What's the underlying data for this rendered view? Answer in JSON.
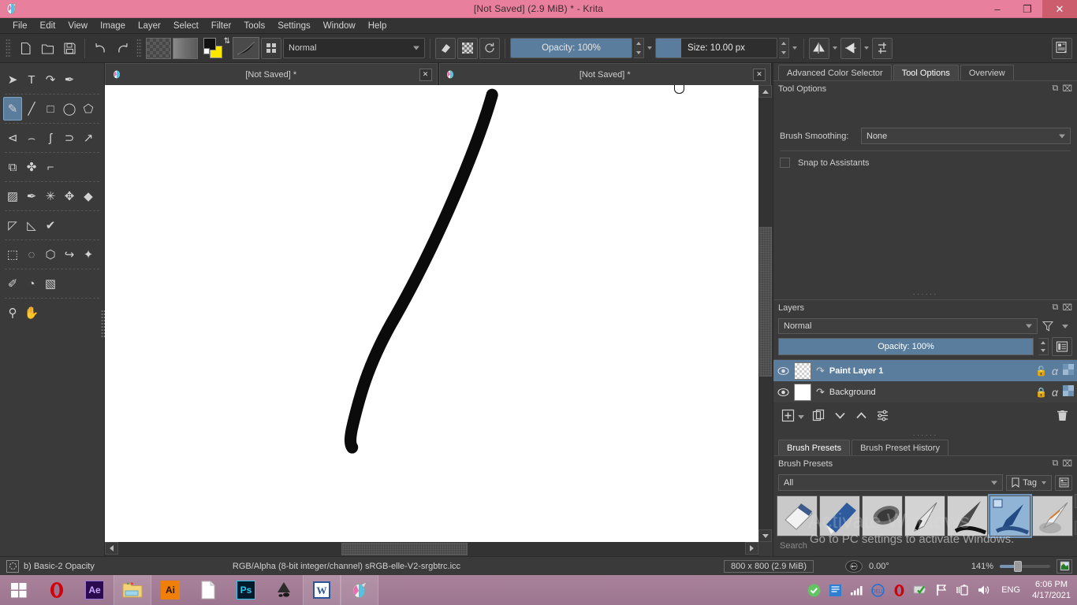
{
  "titlebar": {
    "title": "[Not Saved]  (2.9 MiB)  * - Krita",
    "app_icon": "krita-icon",
    "minimize": "–",
    "maximize": "❐",
    "close": "✕"
  },
  "menubar": {
    "items": [
      {
        "label": "File",
        "accel": "F"
      },
      {
        "label": "Edit",
        "accel": "E"
      },
      {
        "label": "View",
        "accel": "V"
      },
      {
        "label": "Image",
        "accel": "I"
      },
      {
        "label": "Layer",
        "accel": "L"
      },
      {
        "label": "Select",
        "accel": "S"
      },
      {
        "label": "Filter",
        "accel": "r"
      },
      {
        "label": "Tools",
        "accel": "T"
      },
      {
        "label": "Settings",
        "accel": "n"
      },
      {
        "label": "Window",
        "accel": "W"
      },
      {
        "label": "Help",
        "accel": "H"
      }
    ]
  },
  "toolbar": {
    "new_label": "new-file",
    "open_label": "open-file",
    "save_label": "save-file",
    "undo_label": "undo",
    "redo_label": "redo",
    "gradient_label": "gradients",
    "pattern_label": "patterns",
    "blend_mode": "Normal",
    "eraser_label": "eraser-mode",
    "alpha_label": "preserve-alpha",
    "reload_label": "reload-preset",
    "opacity_label": "Opacity: 100%",
    "opacity_value": 100,
    "size_label": "Size: 10.00 px",
    "size_value": "10.00",
    "mirror_x": "mirror-horizontal",
    "mirror_y": "mirror-vertical",
    "wrap": "wrap-around",
    "workspace": "workspace-chooser"
  },
  "toolbox": {
    "tools": [
      {
        "name": "shape-select-tool",
        "glyph": "➤",
        "active": false
      },
      {
        "name": "text-tool",
        "glyph": "T",
        "active": false
      },
      {
        "name": "edit-shapes-tool",
        "glyph": "↷",
        "active": false
      },
      {
        "name": "calligraphy-tool",
        "glyph": "✒",
        "active": false
      },
      {
        "name": "freehand-brush-tool",
        "glyph": "✎",
        "active": true
      },
      {
        "name": "line-tool",
        "glyph": "╱",
        "active": false
      },
      {
        "name": "rectangle-tool",
        "glyph": "□",
        "active": false
      },
      {
        "name": "ellipse-tool",
        "glyph": "◯",
        "active": false
      },
      {
        "name": "polygon-tool",
        "glyph": "⬠",
        "active": false
      },
      {
        "name": "polyline-tool",
        "glyph": "⊲",
        "active": false
      },
      {
        "name": "bezier-curve-tool",
        "glyph": "⌢",
        "active": false
      },
      {
        "name": "freehand-path-tool",
        "glyph": "ʃ",
        "active": false
      },
      {
        "name": "dynamic-brush-tool",
        "glyph": "⊃",
        "active": false
      },
      {
        "name": "multibrush-tool",
        "glyph": "↗",
        "active": false
      },
      {
        "name": "transform-tool",
        "glyph": "⧉",
        "active": false
      },
      {
        "name": "move-tool",
        "glyph": "✤",
        "active": false
      },
      {
        "name": "crop-tool",
        "glyph": "⌐",
        "active": false
      },
      {
        "name": "gradient-tool",
        "glyph": "▨",
        "active": false
      },
      {
        "name": "color-picker-tool",
        "glyph": "✒",
        "active": false
      },
      {
        "name": "colorize-mask-tool",
        "glyph": "✳",
        "active": false
      },
      {
        "name": "smart-patch-tool",
        "glyph": "✥",
        "active": false
      },
      {
        "name": "fill-tool",
        "glyph": "◆",
        "active": false
      },
      {
        "name": "measure-tool",
        "glyph": "◸",
        "active": false
      },
      {
        "name": "reference-images-tool",
        "glyph": "◺",
        "active": false
      },
      {
        "name": "assistant-tool",
        "glyph": "✔",
        "active": false
      },
      {
        "name": "rectangular-selection-tool",
        "glyph": "⬚",
        "active": false
      },
      {
        "name": "elliptical-selection-tool",
        "glyph": "◌",
        "active": false
      },
      {
        "name": "polygonal-selection-tool",
        "glyph": "⬡",
        "active": false
      },
      {
        "name": "freehand-selection-tool",
        "glyph": "↪",
        "active": false
      },
      {
        "name": "contiguous-selection-tool",
        "glyph": "✦",
        "active": false
      },
      {
        "name": "bezier-selection-tool",
        "glyph": "✐",
        "active": false
      },
      {
        "name": "magnetic-selection-tool",
        "glyph": "◔",
        "active": false
      },
      {
        "name": "similar-color-selection-tool",
        "glyph": "▧",
        "active": false
      },
      {
        "name": "zoom-tool",
        "glyph": "⚲",
        "active": false
      },
      {
        "name": "pan-tool",
        "glyph": "✋",
        "active": false
      }
    ]
  },
  "document_tabs": [
    {
      "label": "[Not Saved]",
      "modified": "*",
      "close": "✕",
      "active": false
    },
    {
      "label": "[Not Saved]",
      "modified": "*",
      "close": "✕",
      "active": true
    }
  ],
  "dockers": {
    "top_tabs": [
      {
        "label": "Advanced Color Selector",
        "active": false
      },
      {
        "label": "Tool Options",
        "active": true
      },
      {
        "label": "Overview",
        "active": false
      }
    ],
    "tool_options": {
      "title": "Tool Options",
      "brush_smoothing_label": "Brush Smoothing:",
      "brush_smoothing_value": "None",
      "snap_to_assistants_label": "Snap to Assistants",
      "snap_checked": false
    },
    "layers": {
      "title": "Layers",
      "blend_mode": "Normal",
      "opacity_label": "Opacity:  100%",
      "opacity_value": 100,
      "rows": [
        {
          "name": "Paint Layer 1",
          "visible": true,
          "locked": false,
          "selected": true,
          "thumb": "checker"
        },
        {
          "name": "Background",
          "visible": true,
          "locked": true,
          "selected": false,
          "thumb": "white"
        }
      ],
      "tools": [
        "add-layer",
        "duplicate-layer",
        "move-layer-down",
        "move-layer-up",
        "layer-properties",
        "delete-layer"
      ]
    },
    "brush_presets": {
      "tabs": [
        {
          "label": "Brush Presets",
          "active": true
        },
        {
          "label": "Brush Preset History",
          "active": false
        }
      ],
      "title": "Brush Presets",
      "tag_filter": "All",
      "tag_button": "Tag",
      "search_placeholder": "Search",
      "presets": [
        {
          "name": "eraser-soft",
          "selected": false
        },
        {
          "name": "eraser-small",
          "selected": false
        },
        {
          "name": "airbrush-soft",
          "selected": false
        },
        {
          "name": "ink-pen-fine",
          "selected": false
        },
        {
          "name": "ink-gpen",
          "selected": false
        },
        {
          "name": "basic-2-opacity",
          "selected": true
        },
        {
          "name": "ink-brush-rough",
          "selected": false
        }
      ]
    }
  },
  "statusbar": {
    "brush_preset": "b) Basic-2 Opacity",
    "color_profile": "RGB/Alpha (8-bit integer/channel)  sRGB-elle-V2-srgbtrc.icc",
    "doc_size": "800 x 800 (2.9 MiB)",
    "rotation": "0.00°",
    "zoom": "141%",
    "zoom_value": 141
  },
  "watermark": {
    "line1": "Activate Windows",
    "line2": "Go to PC settings to activate Windows."
  },
  "taskbar": {
    "items": [
      {
        "name": "start-button",
        "label": "⊞"
      },
      {
        "name": "opera-taskbar-icon",
        "label": "O"
      },
      {
        "name": "after-effects-taskbar-icon",
        "label": "Ae"
      },
      {
        "name": "file-explorer-taskbar-icon",
        "label": "📁"
      },
      {
        "name": "illustrator-taskbar-icon",
        "label": "Ai"
      },
      {
        "name": "notepad-taskbar-icon",
        "label": "📄"
      },
      {
        "name": "photoshop-taskbar-icon",
        "label": "Ps"
      },
      {
        "name": "inkscape-taskbar-icon",
        "label": "◆"
      },
      {
        "name": "word-taskbar-icon",
        "label": "W"
      },
      {
        "name": "krita-taskbar-icon",
        "label": "🎨"
      }
    ],
    "tray": [
      {
        "name": "antivirus-tray-icon",
        "label": "✔"
      },
      {
        "name": "bluestacks-tray-icon",
        "label": "▦"
      },
      {
        "name": "network-signal-tray-icon",
        "label": "█"
      },
      {
        "name": "dell-tray-icon",
        "label": "D"
      },
      {
        "name": "opera-tray-icon",
        "label": "O"
      },
      {
        "name": "shield-tray-icon",
        "label": "✔"
      },
      {
        "name": "flag-tray-icon",
        "label": "⚑"
      },
      {
        "name": "battery-tray-icon",
        "label": "▮"
      },
      {
        "name": "volume-tray-icon",
        "label": "🔊"
      }
    ],
    "language": "ENG",
    "time": "6:06 PM",
    "date": "4/17/2021"
  },
  "colors": {
    "titlebar": "#e87f9c",
    "accent": "#5a7d9e",
    "panel": "#3a3a3a",
    "foreground_swatch": "#111111",
    "background_swatch": "#ffe800",
    "stroke": "#000000"
  }
}
